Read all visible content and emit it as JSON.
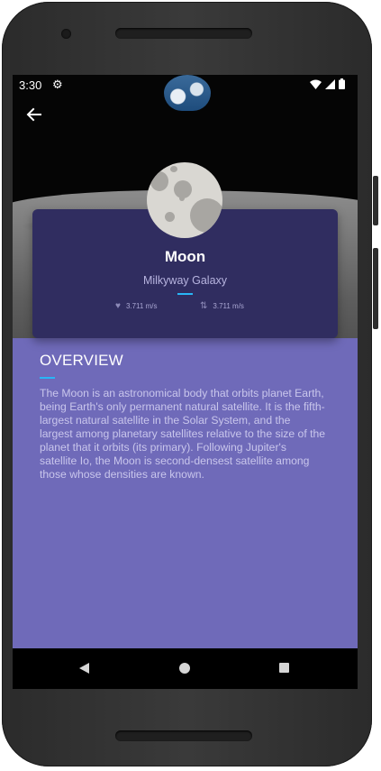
{
  "status_bar": {
    "time": "3:30",
    "icons": [
      "settings-icon",
      "wifi-icon",
      "signal-icon",
      "battery-icon"
    ]
  },
  "planet": {
    "name": "Moon",
    "galaxy": "Milkyway Galaxy",
    "stat_1": {
      "icon": "gravity-icon",
      "value": "3.711 m/s"
    },
    "stat_2": {
      "icon": "arrows-icon",
      "value": "3.711 m/s"
    }
  },
  "overview": {
    "title": "OVERVIEW",
    "text": "The Moon is an astronomical body that orbits planet Earth, being Earth's only permanent natural satellite. It is the fifth-largest natural satellite in the Solar System, and the largest among planetary satellites relative to the size of the planet that it orbits (its primary). Following Jupiter's satellite Io, the Moon is second-densest satellite among those whose densities are known."
  },
  "nav": {
    "icons": [
      "nav-back-icon",
      "nav-home-icon",
      "nav-recents-icon"
    ]
  },
  "colors": {
    "card": "#302d60",
    "content_bg": "#6f6ab9",
    "accent": "#29b6f6"
  }
}
